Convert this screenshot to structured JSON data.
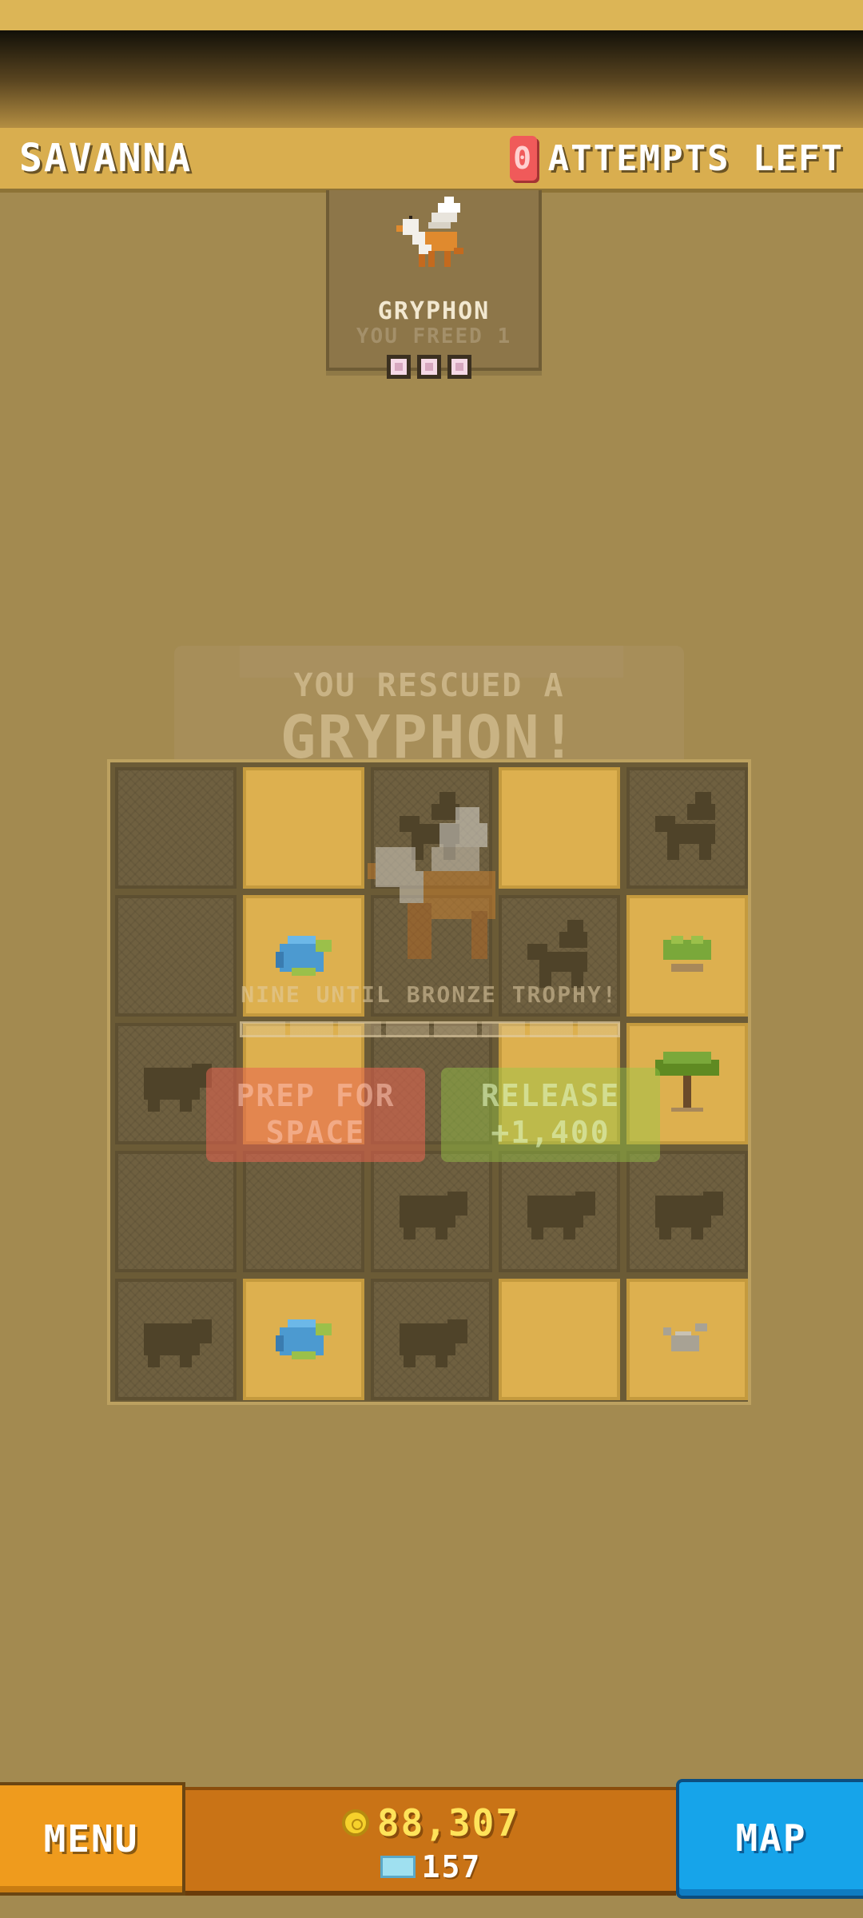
{
  "header": {
    "level_name": "SAVANNA",
    "attempts_count": "0",
    "attempts_label": "ATTEMPTS LEFT"
  },
  "animal_card": {
    "name": "GRYPHON",
    "subtitle": "YOU FREED 1",
    "progress_dots": 3
  },
  "result_overlay": {
    "line1": "YOU RESCUED A",
    "line2": "GRYPHON!",
    "trophy_text": "NINE UNTIL BRONZE TROPHY!",
    "prep_button_label": "PREP FOR SPACE",
    "release_button_label": "RELEASE +1,400"
  },
  "grid": {
    "rows": [
      [
        "dark",
        "dug",
        "dark-gryphon",
        "dug",
        "dark-gryphon"
      ],
      [
        "dark",
        "dug-gem",
        "dark",
        "dark-gryphon",
        "dug-bush"
      ],
      [
        "dark-hippo",
        "dug",
        "dark",
        "dug",
        "dug-tree"
      ],
      [
        "dark",
        "dark",
        "dark-hippo",
        "dark-hippo",
        "dark-hippo"
      ],
      [
        "dark-hippo",
        "dug-gem",
        "dark-hippo",
        "dug",
        "dug-rocks"
      ]
    ]
  },
  "bottom_bar": {
    "menu_label": "MENU",
    "coins": "88,307",
    "gems": "157",
    "map_label": "MAP"
  },
  "colors": {
    "background": "#a38a50",
    "header": "#d9ae4f",
    "menu": "#ef9b1d",
    "map": "#16a4ea",
    "currency_panel": "#c97316",
    "attempts_badge": "#f05a5a"
  }
}
